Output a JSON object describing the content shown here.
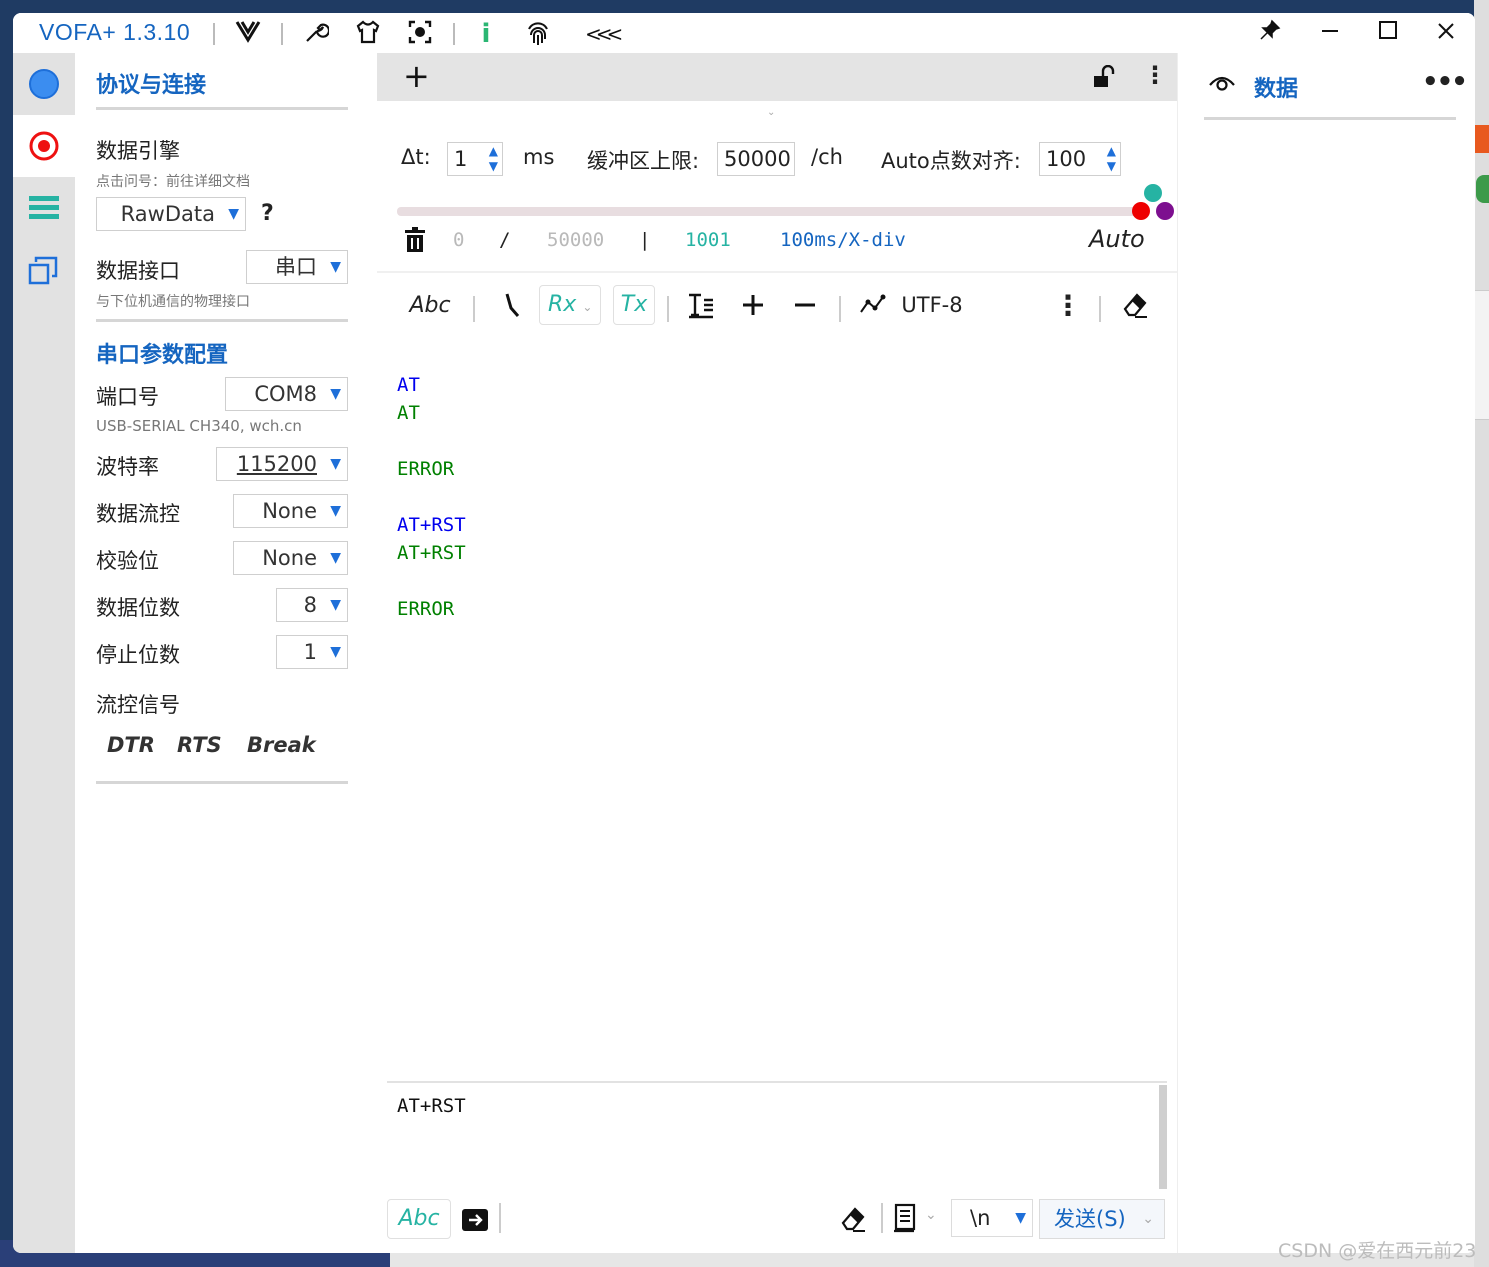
{
  "app": {
    "title": "VOFA+ 1.3.10"
  },
  "config": {
    "section1_title": "协议与连接",
    "engine_label": "数据引擎",
    "engine_hint": "点击问号：前往详细文档",
    "engine_value": "RawData",
    "help": "?",
    "interface_label": "数据接口",
    "interface_value": "串口",
    "interface_hint": "与下位机通信的物理接口",
    "section2_title": "串口参数配置",
    "port_label": "端口号",
    "port_value": "COM8",
    "port_hint": "USB-SERIAL CH340, wch.cn",
    "baud_label": "波特率",
    "baud_value": "115200",
    "flow_label": "数据流控",
    "flow_value": "None",
    "parity_label": "校验位",
    "parity_value": "None",
    "databits_label": "数据位数",
    "databits_value": "8",
    "stopbits_label": "停止位数",
    "stopbits_value": "1",
    "signals_label": "流控信号",
    "signals": [
      "DTR",
      "RTS",
      "Break"
    ]
  },
  "params": {
    "dt_label": "Δt:",
    "dt_value": "1",
    "dt_unit": "ms",
    "buffer_label": "缓冲区上限:",
    "buffer_value": "50000",
    "buffer_unit": "/ch",
    "auto_label": "Auto点数对齐:",
    "auto_value": "100"
  },
  "stats": {
    "current": "0",
    "sep1": "/",
    "max": "50000",
    "sep2": "|",
    "points": "1001",
    "scale": "100ms/X-div",
    "mode": "Auto"
  },
  "toolbar": {
    "abc": "Abc",
    "rx": "Rx",
    "tx": "Tx",
    "encoding": "UTF-8"
  },
  "log": [
    {
      "text": "AT",
      "color": "#0000ee"
    },
    {
      "text": "AT",
      "color": "#008000"
    },
    {
      "text": "",
      "color": "#008000"
    },
    {
      "text": "ERROR",
      "color": "#008000"
    },
    {
      "text": "",
      "color": "#008000"
    },
    {
      "text": "AT+RST",
      "color": "#0000ee"
    },
    {
      "text": "AT+RST",
      "color": "#008000"
    },
    {
      "text": "",
      "color": "#008000"
    },
    {
      "text": "ERROR",
      "color": "#008000"
    }
  ],
  "send": {
    "input_value": "AT+RST",
    "abc": "Abc",
    "line_ending": "\\n",
    "send_label": "发送(S)"
  },
  "right": {
    "title": "数据",
    "more": "•••"
  },
  "colors": {
    "accent": "#1565c0",
    "teal": "#26b3a3",
    "rx_blue": "#0000ee",
    "rx_green": "#008000"
  },
  "watermark": "CSDN @爱在西元前23"
}
